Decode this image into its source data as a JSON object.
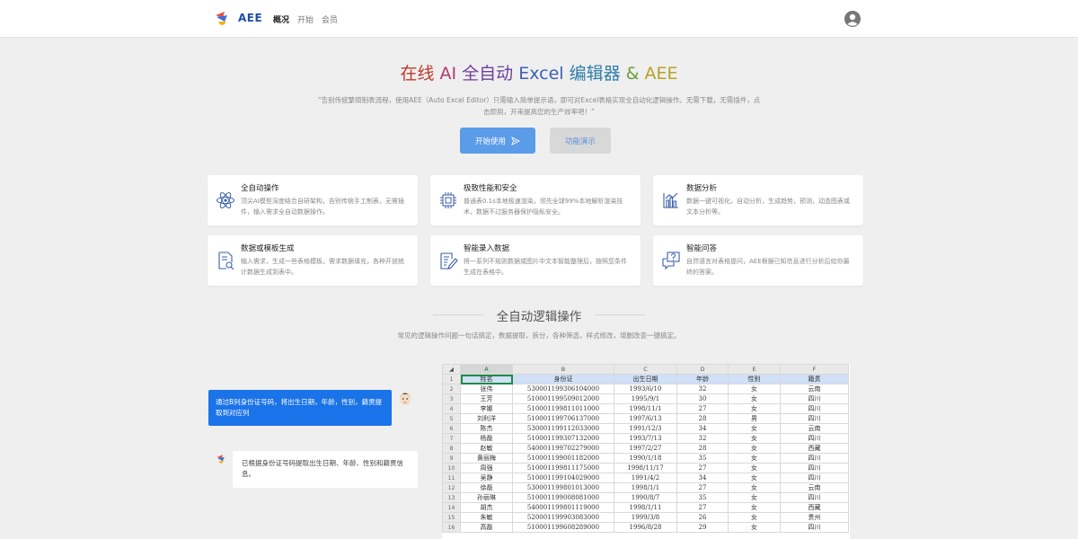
{
  "nav": {
    "brand": "AEE",
    "links": [
      "概况",
      "开始",
      "会员"
    ],
    "active_index": 0
  },
  "hero": {
    "title_parts": [
      "在线 ",
      "AI ",
      "全自动 ",
      "Excel ",
      "编辑器 ",
      "& ",
      "AEE"
    ],
    "description": "“告别传统繁琐制表流程，使用AEE（Auto Excel Editor）只需输入简单提示语，即可对Excel表格实现全自动化逻辑操作。无需下载，无需插件，点击即用，开来提高您的生产效率吧！”",
    "start_label": "开始使用",
    "demo_label": "功能演示"
  },
  "features": [
    {
      "title": "全自动操作",
      "desc": "顶尖AI模型深度结合自研架构，告别传统手工制表，无需插件，输入需求全自动数据操作。",
      "icon": "atom-icon"
    },
    {
      "title": "极致性能和安全",
      "desc": "普通表0.1s本地极速渲染，领先全球99%本地解析渲染技术，数据不过服务器保护隐私安全。",
      "icon": "chip-icon"
    },
    {
      "title": "数据分析",
      "desc": "数据一键可视化，自动分析，生成趋势，预测，动态图表或文本分析等。",
      "icon": "chart-icon"
    },
    {
      "title": "数据或模板生成",
      "desc": "输入需求，生成一些表格模板，需求数据填充，各种开放统计数据生成到表中。",
      "icon": "document-search-icon"
    },
    {
      "title": "智能录入数据",
      "desc": "将一系列不规则数据或图片中文本智能整理后，按照您条件生成在表格中。",
      "icon": "edit-list-icon"
    },
    {
      "title": "智能问答",
      "desc": "自然语言对表格提问，AEE根据已知信息进行分析后给你最终的答案。",
      "icon": "question-chat-icon"
    }
  ],
  "section": {
    "title": "全自动逻辑操作",
    "desc": "常见的逻辑操作问题一句话搞定，数据提取，拆分，各种筛选，样式修改，增删改查一键搞定。"
  },
  "chat": {
    "user_message": "通过B列身份证号码，将出生日期，年龄，性别，籍贯提取到对应列",
    "ai_message": "已根据身份证号码提取出生日期、年龄、性别和籍贯信息。"
  },
  "sheet": {
    "col_letters": [
      "A",
      "B",
      "C",
      "D",
      "E",
      "F"
    ],
    "rows": [
      [
        "姓名",
        "身份证",
        "出生日期",
        "年龄",
        "性别",
        "籍贯"
      ],
      [
        "张伟",
        "530001199306104000",
        "1993/6/10",
        "32",
        "女",
        "云南"
      ],
      [
        "王芳",
        "510001199509012000",
        "1995/9/1",
        "30",
        "女",
        "四川"
      ],
      [
        "李娜",
        "510001199811011000",
        "1998/11/1",
        "27",
        "女",
        "四川"
      ],
      [
        "刘利洋",
        "510001199706137000",
        "1997/6/13",
        "28",
        "男",
        "四川"
      ],
      [
        "陈杰",
        "530001199112033000",
        "1991/12/3",
        "34",
        "女",
        "云南"
      ],
      [
        "杨磊",
        "510001199307132000",
        "1993/7/13",
        "32",
        "女",
        "四川"
      ],
      [
        "赵敏",
        "540001199702279000",
        "1997/2/27",
        "28",
        "女",
        "西藏"
      ],
      [
        "黄丽梅",
        "510001199001182000",
        "1990/1/18",
        "35",
        "女",
        "四川"
      ],
      [
        "周强",
        "510001199811175000",
        "1998/11/17",
        "27",
        "女",
        "四川"
      ],
      [
        "吴静",
        "510001199104029000",
        "1991/4/2",
        "34",
        "女",
        "四川"
      ],
      [
        "徐磊",
        "530001199801013000",
        "1998/1/1",
        "27",
        "女",
        "云南"
      ],
      [
        "孙丽琳",
        "510001199008081000",
        "1990/8/7",
        "35",
        "女",
        "四川"
      ],
      [
        "胡杰",
        "540001199801119000",
        "1998/1/11",
        "27",
        "女",
        "西藏"
      ],
      [
        "朱敏",
        "520001199903083000",
        "1999/3/8",
        "26",
        "女",
        "贵州"
      ],
      [
        "高磊",
        "510001199608289000",
        "1996/8/28",
        "29",
        "女",
        "四川"
      ]
    ]
  }
}
